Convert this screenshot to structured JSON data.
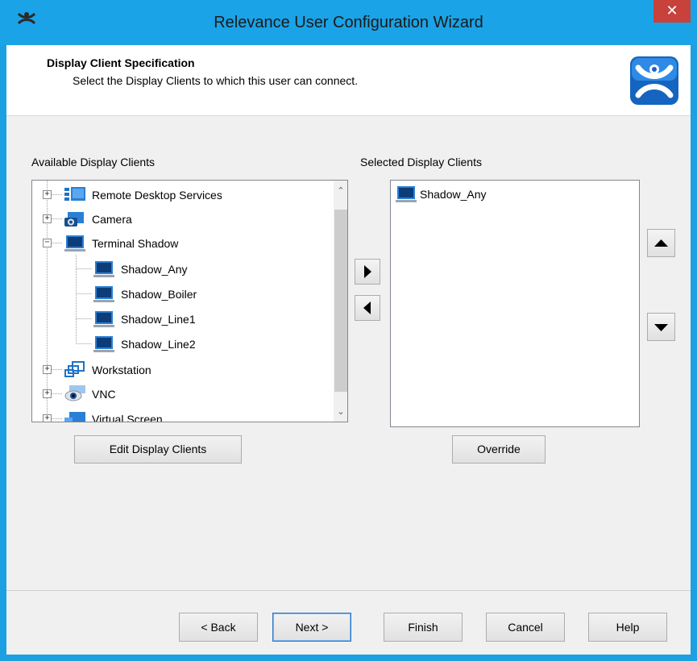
{
  "window": {
    "title": "Relevance User Configuration Wizard",
    "close_glyph": "✕"
  },
  "header": {
    "title": "Display Client Specification",
    "subtitle": "Select the Display Clients to which this user can connect."
  },
  "available": {
    "label": "Available Display Clients",
    "items": [
      {
        "label": "Remote Desktop Services",
        "icon": "remote-desktop-icon",
        "expander": "+"
      },
      {
        "label": "Camera",
        "icon": "camera-icon",
        "expander": "+"
      },
      {
        "label": "Terminal Shadow",
        "icon": "terminal-shadow-icon",
        "expander": "−"
      },
      {
        "label": "Shadow_Any",
        "icon": "monitor-icon"
      },
      {
        "label": "Shadow_Boiler",
        "icon": "monitor-icon"
      },
      {
        "label": "Shadow_Line1",
        "icon": "monitor-icon"
      },
      {
        "label": "Shadow_Line2",
        "icon": "monitor-icon"
      },
      {
        "label": "Workstation",
        "icon": "workstation-icon",
        "expander": "+"
      },
      {
        "label": "VNC",
        "icon": "vnc-eye-icon",
        "expander": "+"
      },
      {
        "label": "Virtual Screen",
        "icon": "virtual-screen-icon",
        "expander": "+"
      }
    ],
    "edit_button": "Edit Display Clients"
  },
  "selected": {
    "label": "Selected Display Clients",
    "items": [
      {
        "label": "Shadow_Any",
        "icon": "monitor-icon"
      }
    ],
    "override_button": "Override"
  },
  "footer": {
    "back": "< Back",
    "next": "Next >",
    "finish": "Finish",
    "cancel": "Cancel",
    "help": "Help"
  },
  "colors": {
    "title_bar": "#1aa3e6",
    "close_button": "#c7423a",
    "dialog_background": "#f0f0f0",
    "tree_icon_blue": "#1e73c8"
  }
}
